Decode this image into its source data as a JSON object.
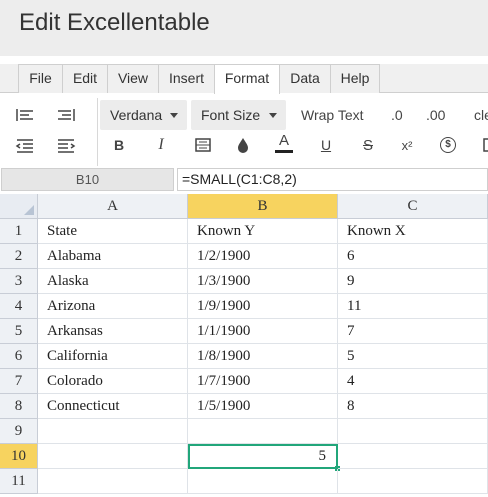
{
  "app": {
    "title": "Edit Excellentable"
  },
  "menu": {
    "tabs": [
      "File",
      "Edit",
      "View",
      "Insert",
      "Format",
      "Data",
      "Help"
    ],
    "active": "Format"
  },
  "toolbar": {
    "font_family": "Verdana",
    "font_size": "Font Size",
    "wrap_text": "Wrap Text",
    "decrease_decimal": ".0",
    "increase_decimal": ".00",
    "clear": "cle",
    "bold": "B",
    "italic": "I",
    "font_color": "A",
    "underline": "U",
    "strikethrough": "S",
    "superscript": "x²",
    "currency": "$"
  },
  "formula_bar": {
    "cell_ref": "B10",
    "formula": "=SMALL(C1:C8,2)"
  },
  "sheet": {
    "columns": [
      "A",
      "B",
      "C"
    ],
    "rows": [
      {
        "num": "1",
        "cells": [
          "State",
          "Known Y",
          "Known X"
        ]
      },
      {
        "num": "2",
        "cells": [
          "Alabama",
          "1/2/1900",
          "6"
        ]
      },
      {
        "num": "3",
        "cells": [
          "Alaska",
          "1/3/1900",
          "9"
        ]
      },
      {
        "num": "4",
        "cells": [
          "Arizona",
          "1/9/1900",
          "11"
        ]
      },
      {
        "num": "5",
        "cells": [
          "Arkansas",
          "1/1/1900",
          "7"
        ]
      },
      {
        "num": "6",
        "cells": [
          "California",
          "1/8/1900",
          "5"
        ]
      },
      {
        "num": "7",
        "cells": [
          "Colorado",
          "1/7/1900",
          "4"
        ]
      },
      {
        "num": "8",
        "cells": [
          "Connecticut",
          "1/5/1900",
          "8"
        ]
      },
      {
        "num": "9",
        "cells": [
          "",
          "",
          ""
        ]
      },
      {
        "num": "10",
        "cells": [
          "",
          "5",
          ""
        ]
      },
      {
        "num": "11",
        "cells": [
          "",
          "",
          ""
        ]
      }
    ],
    "active_cell": {
      "row": "10",
      "col": "B"
    },
    "selection_color": "#f7d35f",
    "active_border_color": "#21a67a"
  }
}
